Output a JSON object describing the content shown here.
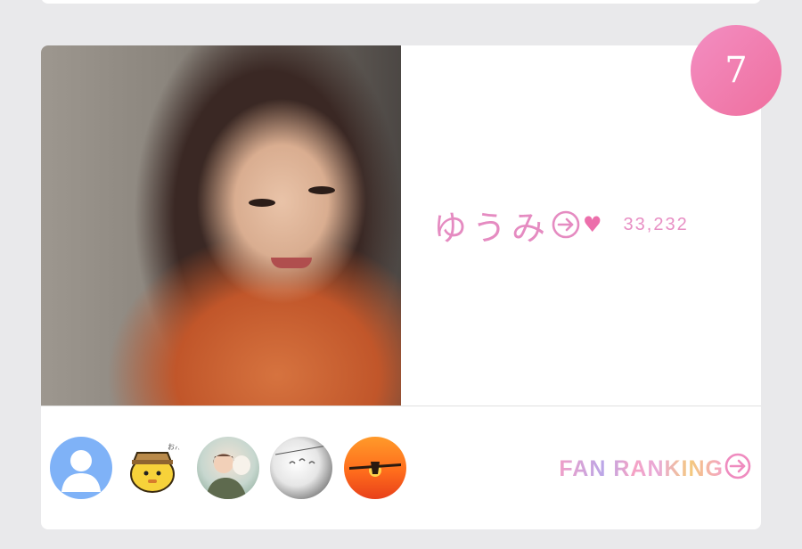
{
  "card": {
    "rank": "7",
    "name": "ゆうみ",
    "likes": "33,232",
    "arrow_icon": "circle-arrow-right-icon",
    "heart_icon": "heart-icon"
  },
  "fans": {
    "avatars": [
      {
        "icon": "default-user-avatar"
      },
      {
        "icon": "yellow-mascot-avatar"
      },
      {
        "icon": "girl-photo-avatar"
      },
      {
        "icon": "sketch-photo-avatar"
      },
      {
        "icon": "sunset-airplane-avatar"
      }
    ],
    "ranking_label": "FAN RANKING",
    "ranking_icon": "circle-arrow-right-icon"
  },
  "colors": {
    "accent_pink": "#e58bc1",
    "badge_pink": "#ef6f9e",
    "background": "#e9e9eb"
  }
}
